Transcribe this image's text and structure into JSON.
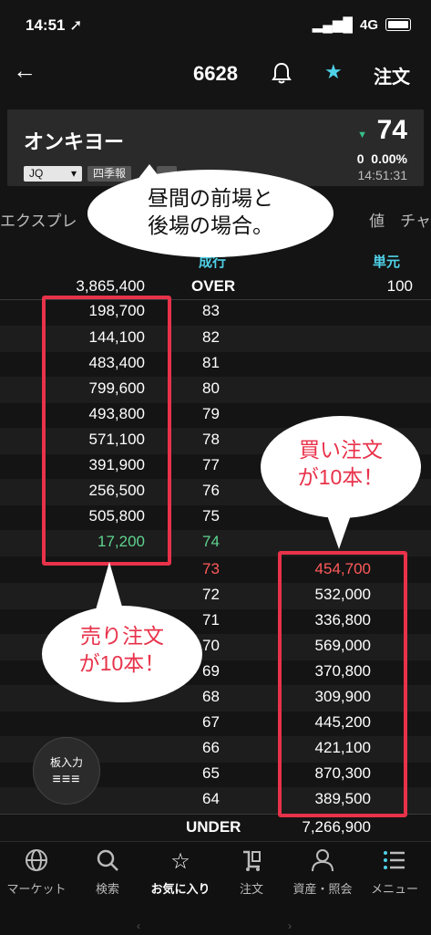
{
  "status": {
    "time": "14:51",
    "network": "4G"
  },
  "nav": {
    "back": "←",
    "code": "6628",
    "order": "注文"
  },
  "stock": {
    "name": "オンキヨー",
    "price": "74",
    "change": "0",
    "change_pct": "0.00%",
    "time": "14:51:31",
    "market": "JQ",
    "tag": "四季報"
  },
  "info": {
    "left": "エクスプレ",
    "right": "値　チャ"
  },
  "board": {
    "col_mid": "成行",
    "col_unit": "単元",
    "over_qty": "3,865,400",
    "over_label": "OVER",
    "unit": "100",
    "sell_rows": [
      {
        "qty": "198,700",
        "price": "83"
      },
      {
        "qty": "144,100",
        "price": "82"
      },
      {
        "qty": "483,400",
        "price": "81"
      },
      {
        "qty": "799,600",
        "price": "80"
      },
      {
        "qty": "493,800",
        "price": "79"
      },
      {
        "qty": "571,100",
        "price": "78"
      },
      {
        "qty": "391,900",
        "price": "77"
      },
      {
        "qty": "256,500",
        "price": "76"
      },
      {
        "qty": "505,800",
        "price": "75"
      },
      {
        "qty": "17,200",
        "price": "74"
      }
    ],
    "buy_rows": [
      {
        "price": "73",
        "qty": "454,700"
      },
      {
        "price": "72",
        "qty": "532,000"
      },
      {
        "price": "71",
        "qty": "336,800"
      },
      {
        "price": "70",
        "qty": "569,000"
      },
      {
        "price": "69",
        "qty": "370,800"
      },
      {
        "price": "68",
        "qty": "309,900"
      },
      {
        "price": "67",
        "qty": "445,200"
      },
      {
        "price": "66",
        "qty": "421,100"
      },
      {
        "price": "65",
        "qty": "870,300"
      },
      {
        "price": "64",
        "qty": "389,500"
      }
    ],
    "under_label": "UNDER",
    "under_qty": "7,266,900"
  },
  "annotations": {
    "top_line1": "昼間の前場と",
    "top_line2": "後場の場合。",
    "buy_line1": "買い注文",
    "buy_line2": "が10本！",
    "sell_line1": "売り注文",
    "sell_line2": "が10本！"
  },
  "fab": {
    "label": "板入力"
  },
  "tabs": [
    {
      "label": "マーケット",
      "icon": "globe-icon"
    },
    {
      "label": "検索",
      "icon": "search-icon"
    },
    {
      "label": "お気に入り",
      "icon": "star-icon"
    },
    {
      "label": "注文",
      "icon": "order-icon"
    },
    {
      "label": "資産・照会",
      "icon": "person-icon"
    },
    {
      "label": "メニュー",
      "icon": "menu-icon"
    }
  ],
  "colors": {
    "accent": "#4fd1e8",
    "up": "#5fd38f",
    "down": "#ff5a5a",
    "highlight": "#e8324a"
  }
}
